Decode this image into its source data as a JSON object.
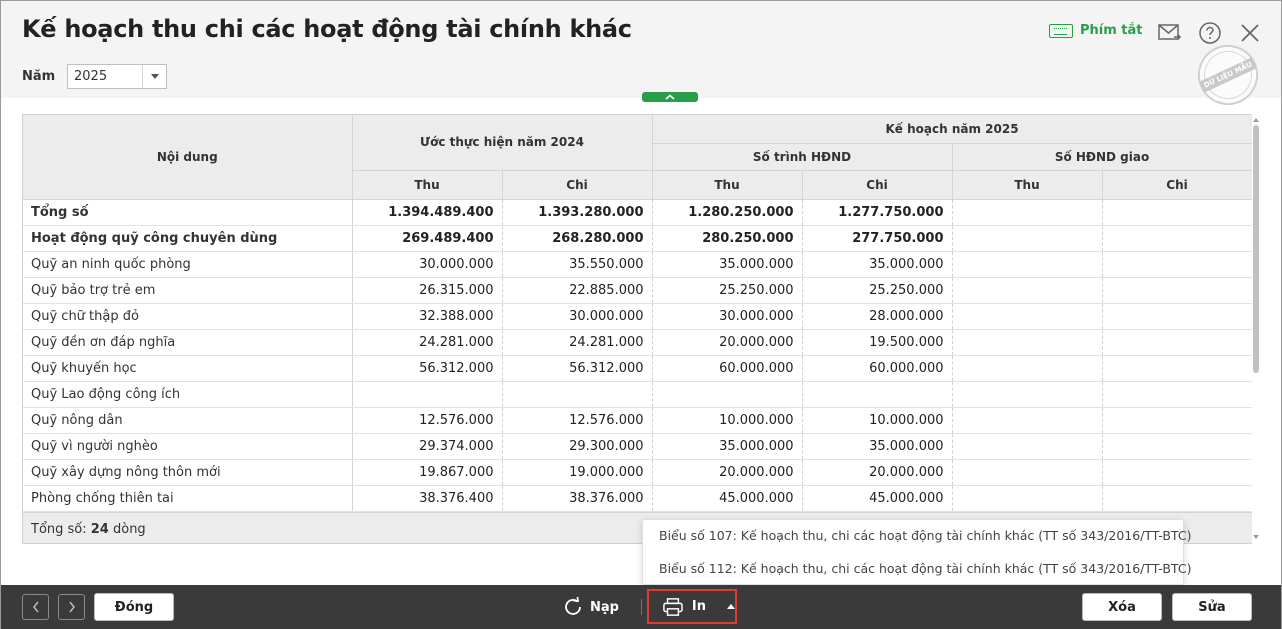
{
  "header": {
    "title": "Kế hoạch thu chi các hoạt động tài chính khác",
    "shortcut_label": "Phím tắt",
    "stamp_text": "DỮ LIỆU MẪU"
  },
  "filter": {
    "year_label": "Năm",
    "year_value": "2025"
  },
  "table": {
    "headers": {
      "content": "Nội dung",
      "estimate_2024": "Ước thực hiện năm 2024",
      "plan_2025": "Kế hoạch năm 2025",
      "submitted": "Số trình HĐND",
      "assigned": "Số HĐND giao",
      "thu": "Thu",
      "chi": "Chi"
    },
    "rows": [
      {
        "name": "Tổng số",
        "bold": true,
        "c1": "1.394.489.400",
        "c2": "1.393.280.000",
        "c3": "1.280.250.000",
        "c4": "1.277.750.000",
        "c5": "",
        "c6": ""
      },
      {
        "name": "Hoạt động quỹ công chuyên dùng",
        "bold": true,
        "c1": "269.489.400",
        "c2": "268.280.000",
        "c3": "280.250.000",
        "c4": "277.750.000",
        "c5": "",
        "c6": ""
      },
      {
        "name": "Quỹ an ninh quốc phòng",
        "c1": "30.000.000",
        "c2": "35.550.000",
        "c3": "35.000.000",
        "c4": "35.000.000",
        "c5": "",
        "c6": ""
      },
      {
        "name": "Quỹ bảo trợ trẻ em",
        "c1": "26.315.000",
        "c2": "22.885.000",
        "c3": "25.250.000",
        "c4": "25.250.000",
        "c5": "",
        "c6": ""
      },
      {
        "name": "Quỹ chữ thập đỏ",
        "c1": "32.388.000",
        "c2": "30.000.000",
        "c3": "30.000.000",
        "c4": "28.000.000",
        "c5": "",
        "c6": ""
      },
      {
        "name": "Quỹ đền ơn đáp nghĩa",
        "c1": "24.281.000",
        "c2": "24.281.000",
        "c3": "20.000.000",
        "c4": "19.500.000",
        "c5": "",
        "c6": ""
      },
      {
        "name": "Quỹ khuyến học",
        "c1": "56.312.000",
        "c2": "56.312.000",
        "c3": "60.000.000",
        "c4": "60.000.000",
        "c5": "",
        "c6": ""
      },
      {
        "name": "Quỹ Lao động công ích",
        "c1": "",
        "c2": "",
        "c3": "",
        "c4": "",
        "c5": "",
        "c6": ""
      },
      {
        "name": "Quỹ nông dân",
        "c1": "12.576.000",
        "c2": "12.576.000",
        "c3": "10.000.000",
        "c4": "10.000.000",
        "c5": "",
        "c6": ""
      },
      {
        "name": "Quỹ vì người nghèo",
        "c1": "29.374.000",
        "c2": "29.300.000",
        "c3": "35.000.000",
        "c4": "35.000.000",
        "c5": "",
        "c6": ""
      },
      {
        "name": "Quỹ xây dựng nông thôn mới",
        "c1": "19.867.000",
        "c2": "19.000.000",
        "c3": "20.000.000",
        "c4": "20.000.000",
        "c5": "",
        "c6": ""
      },
      {
        "name": "Phòng chống thiên tai",
        "c1": "38.376.400",
        "c2": "38.376.000",
        "c3": "45.000.000",
        "c4": "45.000.000",
        "c5": "",
        "c6": ""
      }
    ],
    "summary_prefix": "Tổng số: ",
    "summary_count": "24",
    "summary_suffix": " dòng"
  },
  "print_menu": {
    "items": [
      "Biểu số 107: Kế hoạch thu, chi các hoạt động tài chính khác (TT số 343/2016/TT-BTC)",
      "Biểu số 112: Kế hoạch thu, chi các hoạt động tài chính khác (TT số 343/2016/TT-BTC)"
    ]
  },
  "footer": {
    "close_label": "Đóng",
    "reload_label": "Nạp",
    "print_label": "In",
    "delete_label": "Xóa",
    "edit_label": "Sửa"
  },
  "colors": {
    "accent_green": "#2a9d4a",
    "footer_bg": "#3a3a3a",
    "highlight_red": "#e53935"
  }
}
